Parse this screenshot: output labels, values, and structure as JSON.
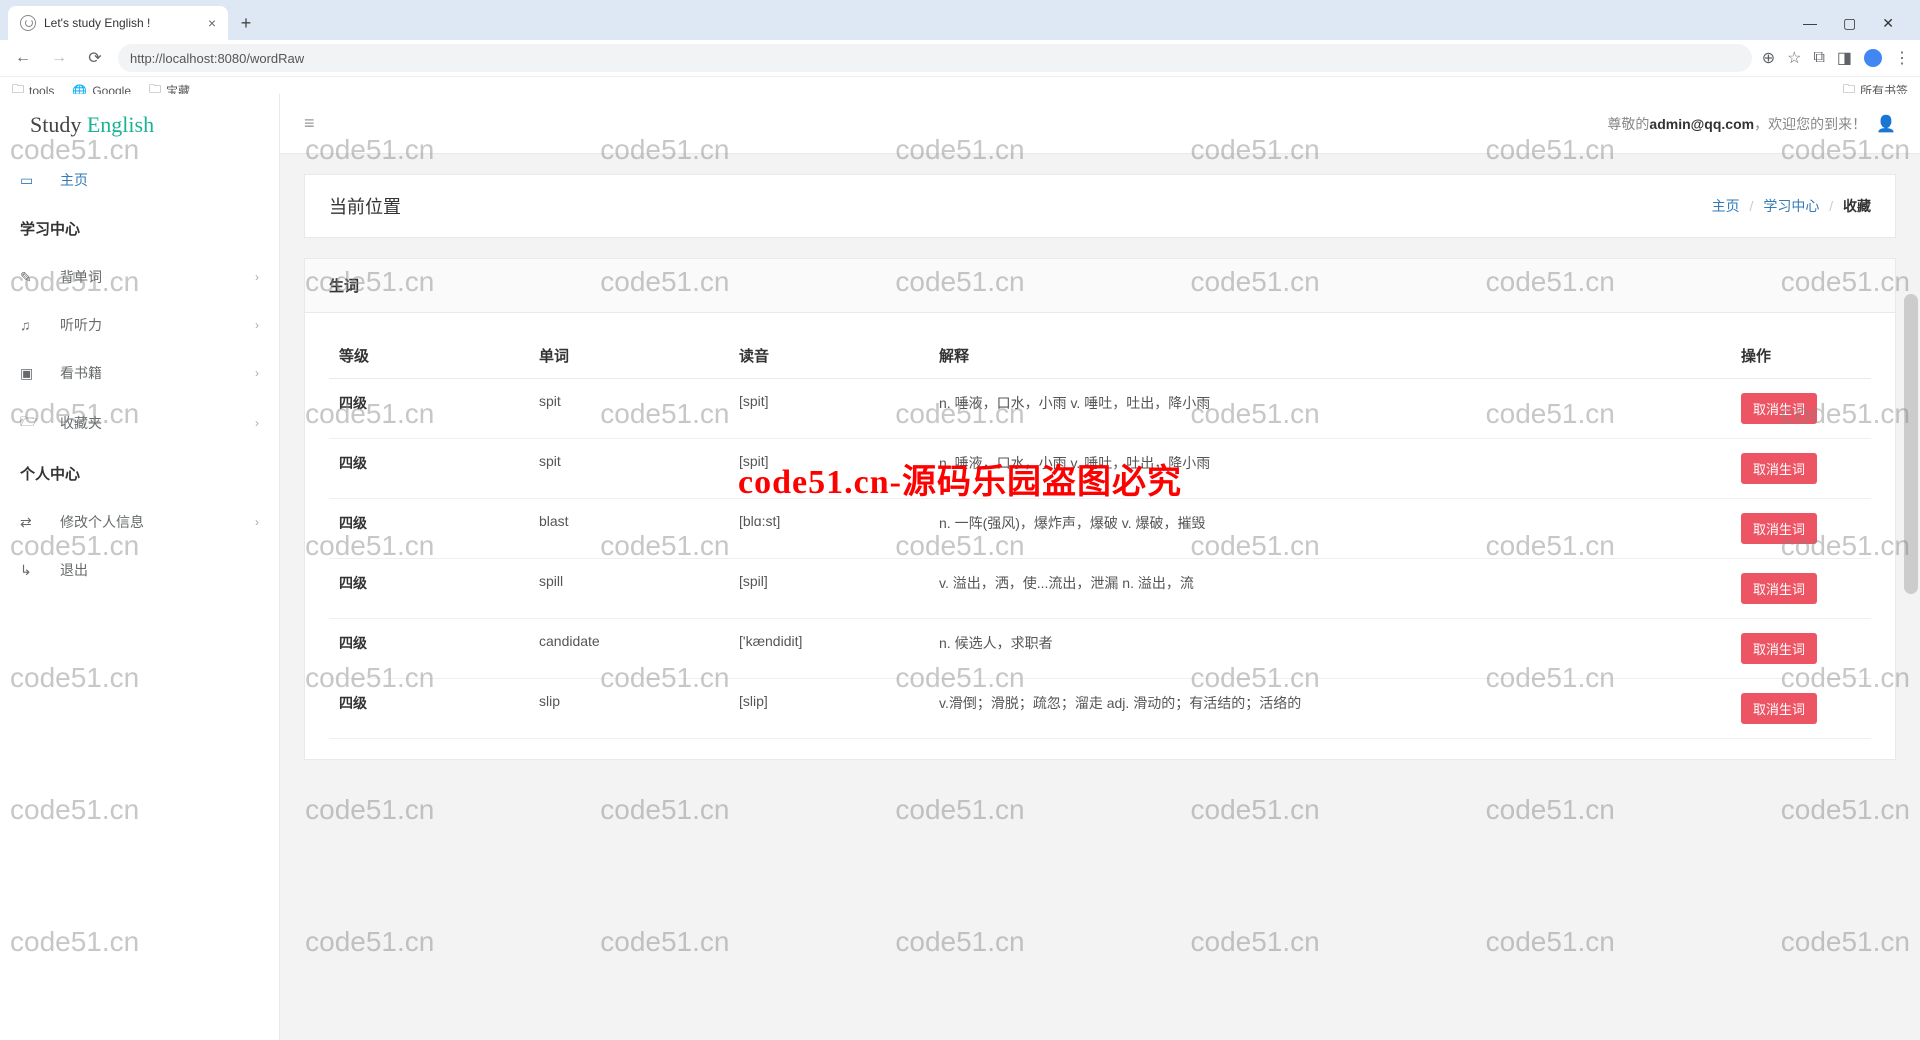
{
  "browser": {
    "tab_title": "Let's study English !",
    "url": "http://localhost:8080/wordRaw",
    "bookmarks": [
      "tools",
      "Google",
      "宝藏"
    ],
    "all_bookmarks": "所有书签"
  },
  "logo": {
    "left": "Study",
    "right": "English"
  },
  "sidebar": {
    "home": "主页",
    "section_learn": "学习中心",
    "items_learn": [
      "背单词",
      "听听力",
      "看书籍",
      "收藏夹"
    ],
    "section_personal": "个人中心",
    "items_personal": [
      "修改个人信息",
      "退出"
    ]
  },
  "topbar": {
    "greeting_prefix": "尊敬的",
    "user": "admin@qq.com",
    "greeting_suffix": "，欢迎您的到来！"
  },
  "location": {
    "title": "当前位置",
    "breadcrumb": [
      "主页",
      "学习中心",
      "收藏"
    ]
  },
  "panel": {
    "title": "生词",
    "columns": [
      "等级",
      "单词",
      "读音",
      "解释",
      "操作"
    ],
    "action_label": "取消生词",
    "rows": [
      {
        "level": "四级",
        "word": "spit",
        "pron": "[spit]",
        "meaning": "n. 唾液，口水，小雨 v. 唾吐，吐出，降小雨"
      },
      {
        "level": "四级",
        "word": "spit",
        "pron": "[spit]",
        "meaning": "n. 唾液，口水，小雨 v. 唾吐，吐出，降小雨"
      },
      {
        "level": "四级",
        "word": "blast",
        "pron": "[blɑ:st]",
        "meaning": "n. 一阵(强风)，爆炸声，爆破 v. 爆破，摧毁"
      },
      {
        "level": "四级",
        "word": "spill",
        "pron": "[spil]",
        "meaning": "v. 溢出，洒，使...流出，泄漏 n. 溢出，流"
      },
      {
        "level": "四级",
        "word": "candidate",
        "pron": "['kændidit]",
        "meaning": "n. 候选人，求职者"
      },
      {
        "level": "四级",
        "word": "slip",
        "pron": "[slip]",
        "meaning": "v.滑倒；滑脱；疏忽；溜走 adj. 滑动的；有活结的；活络的"
      }
    ]
  },
  "watermark": {
    "text": "code51.cn",
    "red": "code51.cn-源码乐园盗图必究"
  }
}
